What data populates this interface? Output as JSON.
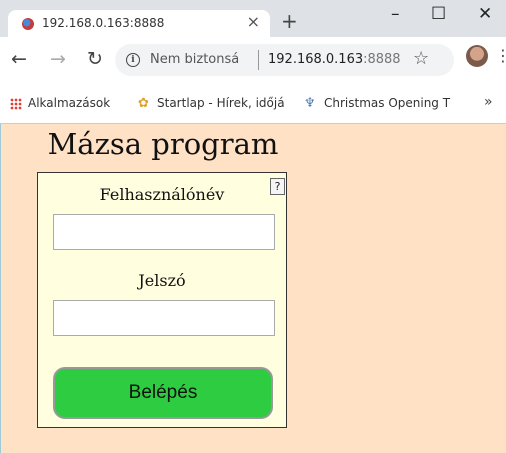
{
  "browser": {
    "tab_title": "192.168.0.163:8888",
    "tab_close": "×",
    "new_tab": "+",
    "minimize": "–",
    "maximize": "☐",
    "close": "✕",
    "security_text": "Nem biztonsá",
    "url_host": "192.168.0.163",
    "url_port": ":8888",
    "bookmarks": [
      "Alkalmazások",
      "Startlap - Hírek, időjá",
      "Christmas Opening T"
    ],
    "more": "»"
  },
  "page": {
    "title": "Mázsa program",
    "help": "?",
    "username_label": "Felhasználónév",
    "username_value": "",
    "password_label": "Jelszó",
    "password_value": "",
    "login_button": "Belépés"
  },
  "colors": {
    "page_bg": "#ffe2c6",
    "panel_bg": "#ffffe0",
    "login_button": "#2ecc40"
  }
}
